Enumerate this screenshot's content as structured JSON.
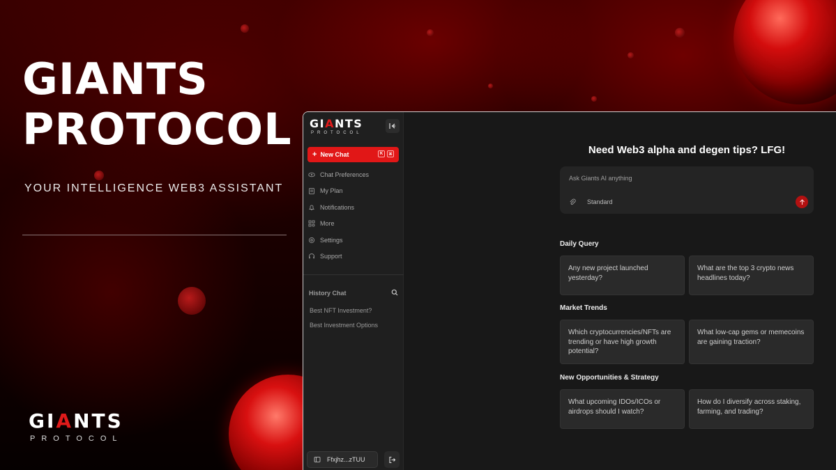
{
  "hero": {
    "title_line1": "GIANTS",
    "title_line2": "PROTOCOL",
    "subtitle": "YOUR INTELLIGENCE WEB3 ASSISTANT"
  },
  "logo": {
    "word_prefix": "GI",
    "word_accent": "A",
    "word_suffix": "NTS",
    "tagline": "PROTOCOL"
  },
  "sidebar": {
    "new_chat_label": "New Chat",
    "shortcut_keys": [
      "K",
      "⌘"
    ],
    "items": [
      {
        "label": "Chat Preferences",
        "icon": "eye-icon"
      },
      {
        "label": "My Plan",
        "icon": "clipboard-icon"
      },
      {
        "label": "Notifications",
        "icon": "bell-icon"
      },
      {
        "label": "More",
        "icon": "grid-icon"
      },
      {
        "label": "Settings",
        "icon": "gear-icon"
      },
      {
        "label": "Support",
        "icon": "headset-icon"
      }
    ],
    "history_title": "History Chat",
    "history": [
      "Best NFT Investment?",
      "Best Investment Options"
    ],
    "wallet_label": "Ffxjhz...zTUU"
  },
  "main": {
    "title": "Need Web3 alpha and degen tips? LFG!",
    "ask_placeholder": "Ask Giants AI anything",
    "mode_label": "Standard",
    "sections": [
      {
        "title": "Daily Query",
        "cards": [
          "Any new project launched yesterday?",
          "What are the top 3 crypto news headlines today?"
        ]
      },
      {
        "title": "Market Trends",
        "cards": [
          "Which cryptocurrencies/NFTs are trending or have high growth potential?",
          "What low-cap gems or memecoins are gaining traction?"
        ]
      },
      {
        "title": "New Opportunities & Strategy",
        "cards": [
          "What upcoming IDOs/ICOs or airdrops should I watch?",
          "How do I diversify across staking, farming, and trading?"
        ]
      }
    ]
  },
  "colors": {
    "accent": "#e11717",
    "panel": "#1f1f1f",
    "card": "#2a2a2a"
  }
}
